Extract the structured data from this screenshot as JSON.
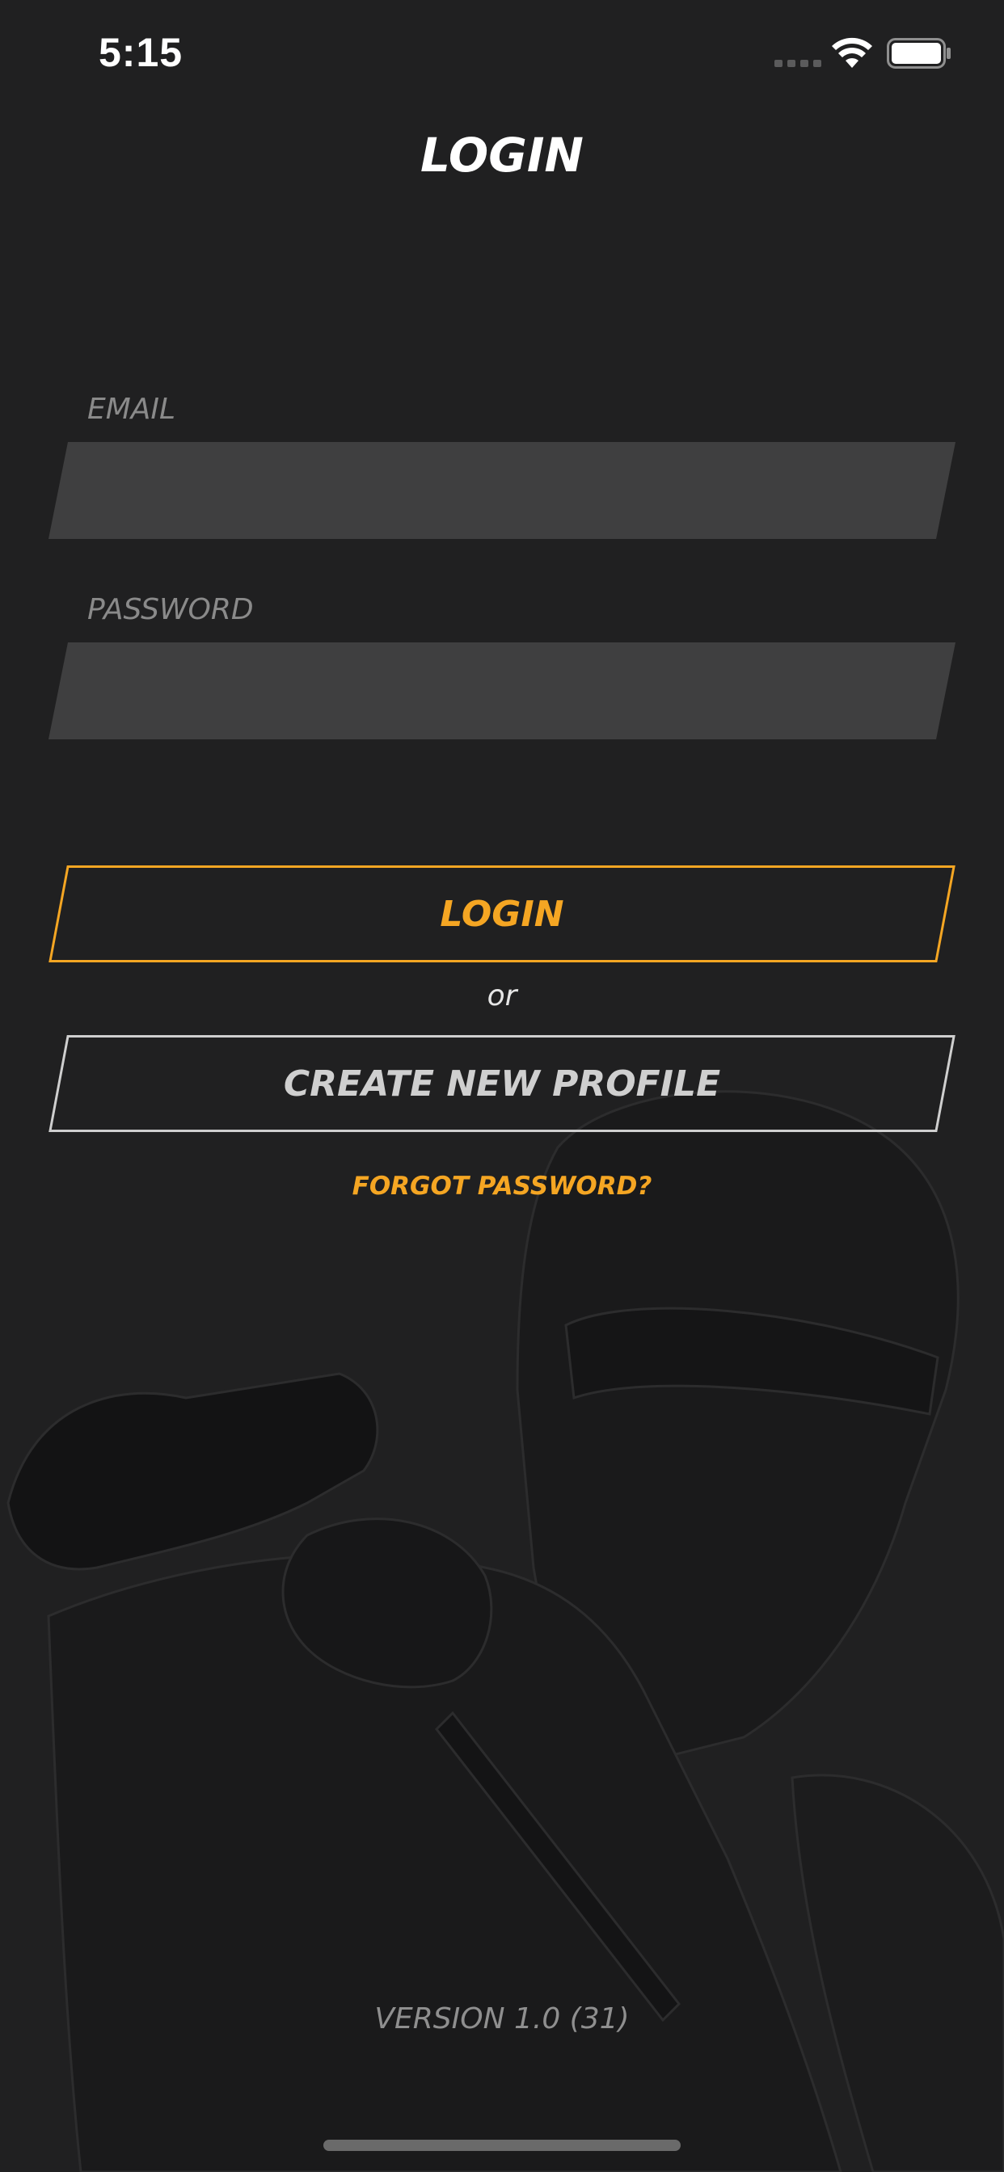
{
  "status_bar": {
    "time": "5:15"
  },
  "header": {
    "title": "LOGIN"
  },
  "form": {
    "email_label": "EMAIL",
    "email_value": "",
    "password_label": "PASSWORD",
    "password_value": ""
  },
  "actions": {
    "login_label": "LOGIN",
    "or_text": "or",
    "create_profile_label": "CREATE NEW PROFILE",
    "forgot_password_label": "FORGOT PASSWORD?"
  },
  "footer": {
    "version": "VERSION 1.0 (31)"
  },
  "colors": {
    "background": "#202021",
    "accent": "#f5a623",
    "field": "#3f3f40",
    "muted": "#8a8a8a"
  },
  "icons": [
    "signal-icon",
    "wifi-icon",
    "battery-icon"
  ]
}
